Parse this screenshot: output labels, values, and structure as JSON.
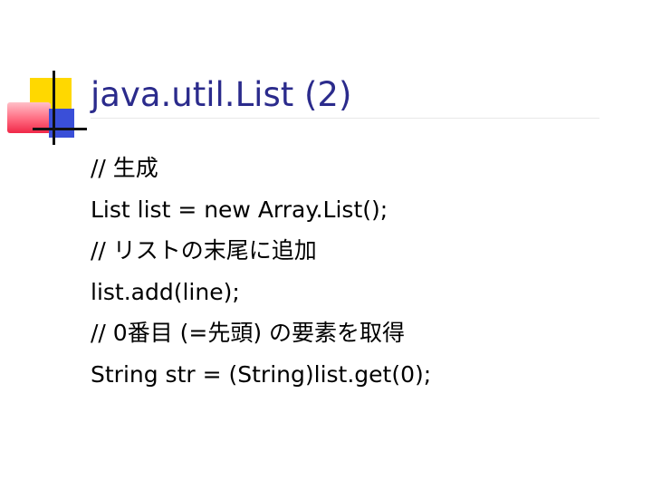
{
  "slide": {
    "title": "java.util.List (2)",
    "lines": [
      "// 生成",
      "List list = new Array.List();",
      "// リストの末尾に追加",
      "list.add(line);",
      "// 0番目 (=先頭) の要素を取得",
      "String str = (String)list.get(0);"
    ]
  },
  "colors": {
    "title": "#2b2b8c",
    "body_text": "#000000",
    "background": "#ffffff",
    "logo_yellow": "#ffd800",
    "logo_red": "#f02848",
    "logo_blue": "#3a4fd8"
  }
}
